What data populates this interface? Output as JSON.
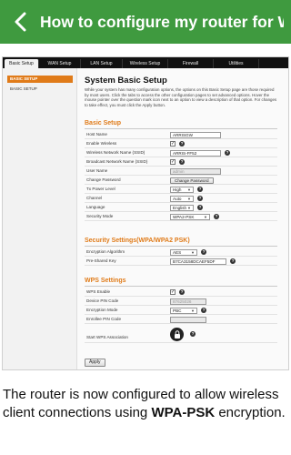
{
  "header": {
    "title": "How to configure my router for WPA-PSK encryption",
    "bg_color": "#3f9a3f"
  },
  "router_ui": {
    "nav_tabs": [
      {
        "label": "Basic Setup",
        "active": true
      },
      {
        "label": "WAN Setup",
        "active": false
      },
      {
        "label": "LAN Setup",
        "active": false
      },
      {
        "label": "Wireless Setup",
        "active": false
      },
      {
        "label": "Firewall",
        "active": false
      },
      {
        "label": "Utilities",
        "active": false
      }
    ],
    "sidebar": {
      "active_item": "BASIC SETUP",
      "items": [
        "BASIC SETUP"
      ]
    },
    "page_title": "System Basic Setup",
    "description": "While your system has many configuration options, the options on this Basic Setup page are those required by most users. Click the tabs to access the other configuration pages to set advanced options. Hover the mouse pointer over the question mark icon next to an option to view a description of that option. For changes to take effect, you must click the Apply button.",
    "basic": {
      "heading": "Basic Setup",
      "host_name": {
        "label": "Host Name",
        "value": "ARRISGW"
      },
      "enable_wireless": {
        "label": "Enable Wireless",
        "checked": true
      },
      "ssid": {
        "label": "Wireless Network Name (SSID)",
        "value": "ARRIS-FF52"
      },
      "broadcast_ssid": {
        "label": "Broadcast Network Name (SSID)",
        "checked": true
      },
      "user_name": {
        "label": "User Name",
        "value": "admin"
      },
      "change_password": {
        "label": "Change Password",
        "button": "Change Password"
      },
      "tx_power": {
        "label": "Tx Power Level",
        "value": "High"
      },
      "channel": {
        "label": "Channel",
        "value": "Auto"
      },
      "language": {
        "label": "Language",
        "value": "English"
      },
      "security_mode": {
        "label": "Security Mode",
        "value": "WPA2-PSK"
      }
    },
    "security": {
      "heading": "Security Settings(WPA/WPA2 PSK)",
      "encryption": {
        "label": "Encryption Algorithm",
        "value": "AES"
      },
      "psk": {
        "label": "Pre-Shared Key",
        "value": "B7CA3158DCAEF5DF"
      }
    },
    "wps": {
      "heading": "WPS Settings",
      "enable": {
        "label": "WPS Enable",
        "checked": true
      },
      "pin": {
        "label": "Device PIN Code",
        "value": "87625026"
      },
      "mode": {
        "label": "Encryption Mode",
        "value": "PBC"
      },
      "enrollee": {
        "label": "Enrollee PIN Code",
        "value": ""
      },
      "start": {
        "label": "Start WPS Association"
      }
    },
    "apply_label": "Apply",
    "accent_color": "#e07b19"
  },
  "caption": {
    "before": "The router is now configured to allow wireless client connections using ",
    "bold": "WPA-PSK",
    "after": " encryption."
  }
}
